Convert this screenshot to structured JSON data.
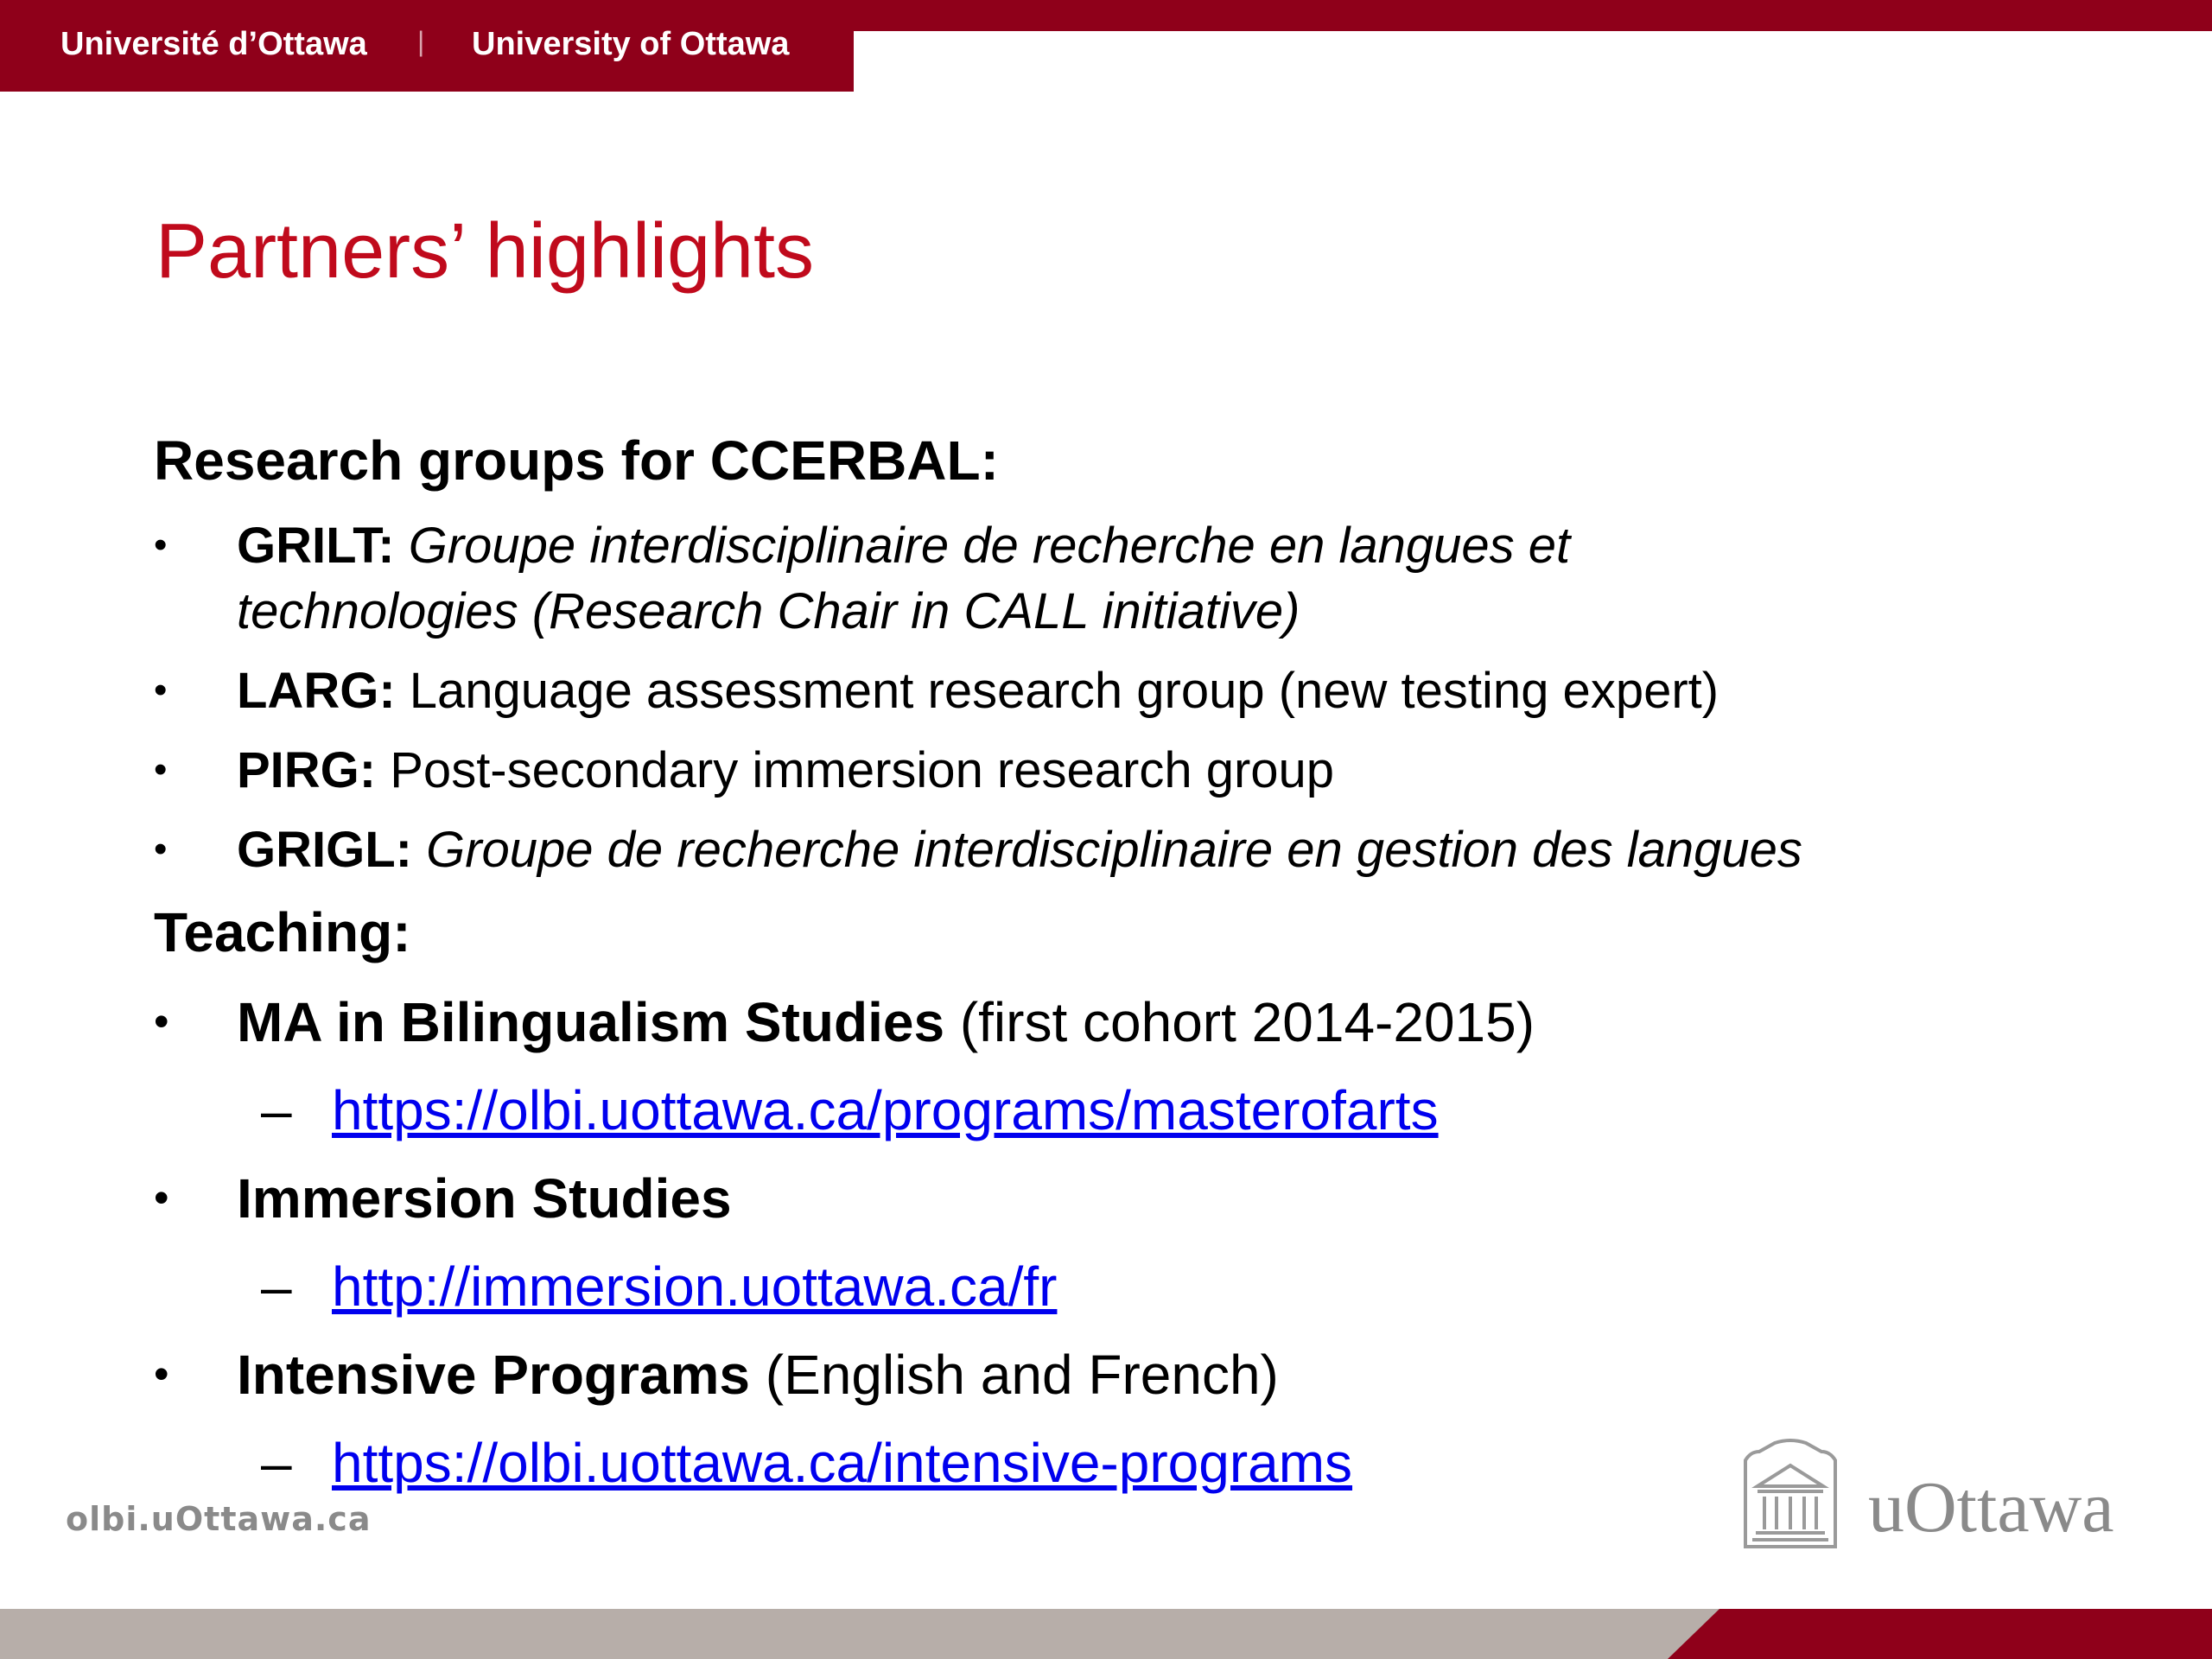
{
  "banner": {
    "french": "Université d’Ottawa",
    "separator": "|",
    "english": "University of Ottawa"
  },
  "title": "Partners’ highlights",
  "research": {
    "heading": "Research groups for CCERBAL:",
    "items": [
      {
        "bullet": "•",
        "abbr": "GRILT:",
        "desc_line1": "Groupe interdisciplinaire de recherche en langues et",
        "desc_line2": "technologies (Research Chair in CALL initiative)"
      },
      {
        "bullet": "•",
        "abbr": "LARG:",
        "desc": "Language assessment research group (new testing expert)"
      },
      {
        "bullet": "•",
        "abbr": "PIRG:",
        "desc": "Post-secondary immersion research group"
      },
      {
        "bullet": "•",
        "abbr": "GRIGL:",
        "desc": "Groupe de recherche interdisciplinaire en gestion des langues"
      }
    ]
  },
  "teaching": {
    "heading": "Teaching:",
    "items": [
      {
        "bullet": "•",
        "name": "MA in Bilingualism Studies",
        "note": " (first cohort 2014-2015)",
        "dash": "–",
        "link": "https://olbi.uottawa.ca/programs/masterofarts"
      },
      {
        "bullet": "•",
        "name": "Immersion Studies",
        "note": "",
        "dash": "–",
        "link": "http://immersion.uottawa.ca/fr"
      },
      {
        "bullet": "•",
        "name": "Intensive Programs",
        "note": " (English and French)",
        "dash": "–",
        "link": "https://olbi.uottawa.ca/intensive-programs"
      }
    ]
  },
  "footer": {
    "url": "olbi.uOttawa.ca",
    "logo_text": "uOttawa",
    "logo_icon": "building-icon"
  },
  "colors": {
    "brand": "#8f001a",
    "title": "#c00a1c",
    "link": "#0000ee",
    "gray": "#8a8a8a",
    "bottom_bar": "#b7aea9"
  }
}
